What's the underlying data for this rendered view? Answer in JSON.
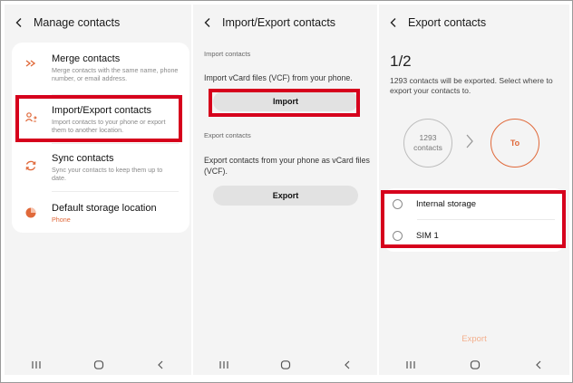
{
  "panel1": {
    "title": "Manage contacts",
    "items": [
      {
        "title": "Merge contacts",
        "subtitle": "Merge contacts with the same name, phone number, or email address."
      },
      {
        "title": "Import/Export contacts",
        "subtitle": "Import contacts to your phone or export them to another location."
      },
      {
        "title": "Sync contacts",
        "subtitle": "Sync your contacts to keep them up to date."
      },
      {
        "title": "Default storage location",
        "subtitle": "Phone"
      }
    ]
  },
  "panel2": {
    "title": "Import/Export contacts",
    "import_section": "Import contacts",
    "import_desc": "Import vCard files (VCF) from your phone.",
    "import_button": "Import",
    "export_section": "Export contacts",
    "export_desc": "Export contacts from your phone as vCard files (VCF).",
    "export_button": "Export"
  },
  "panel3": {
    "title": "Export contacts",
    "step": "1/2",
    "desc": "1293 contacts will be exported. Select where to export your contacts to.",
    "count_number": "1293",
    "count_label": "contacts",
    "to_label": "To",
    "options": [
      "Internal storage",
      "SIM 1"
    ],
    "export_button": "Export"
  },
  "colors": {
    "accent": "#e0693a",
    "highlight": "#d6001c"
  },
  "icons": {
    "back": "chevron-left-icon",
    "merge": "merge-arrows-icon",
    "import_export": "person-transfer-icon",
    "sync": "sync-icon",
    "storage": "pie-storage-icon",
    "nav_recent": "recent-apps-icon",
    "nav_home": "home-icon",
    "nav_back": "nav-back-icon"
  }
}
